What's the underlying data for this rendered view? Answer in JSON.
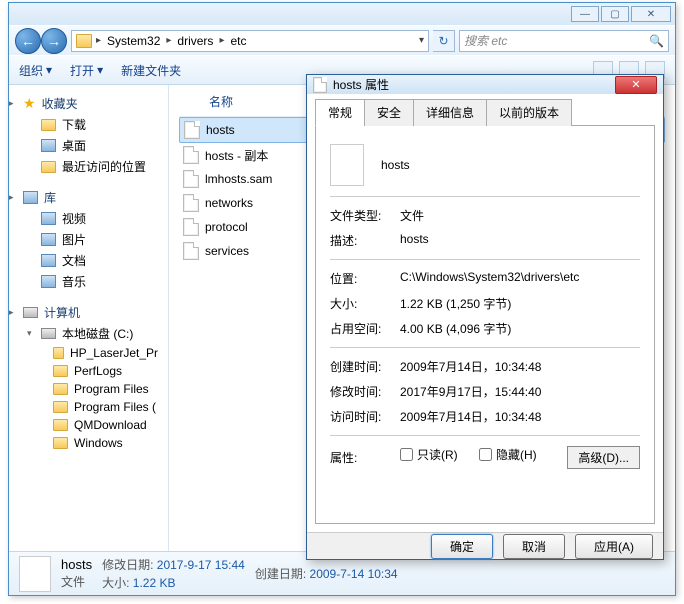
{
  "titlebar": {
    "min": "—",
    "max": "▢",
    "close": "✕"
  },
  "nav": {
    "back": "←",
    "forward": "→"
  },
  "breadcrumb": {
    "p1": "System32",
    "p2": "drivers",
    "p3": "etc"
  },
  "search": {
    "placeholder": "搜索 etc",
    "icon": "🔍"
  },
  "toolbar": {
    "organize": "组织",
    "open": "打开",
    "newfolder": "新建文件夹",
    "dropdown": "▾"
  },
  "sidebar": {
    "favorites": "收藏夹",
    "fav_items": [
      "下载",
      "桌面",
      "最近访问的位置"
    ],
    "libraries": "库",
    "lib_items": [
      "视频",
      "图片",
      "文档",
      "音乐"
    ],
    "computer": "计算机",
    "drives": [
      "本地磁盘 (C:)"
    ],
    "folders": [
      "HP_LaserJet_Pr",
      "PerfLogs",
      "Program Files",
      "Program Files (",
      "QMDownload",
      "Windows"
    ]
  },
  "filelist": {
    "header": "名称",
    "items": [
      "hosts",
      "hosts - 副本",
      "lmhosts.sam",
      "networks",
      "protocol",
      "services"
    ]
  },
  "details": {
    "name": "hosts",
    "type": "文件",
    "mod_label": "修改日期:",
    "mod_val": "2017-9-17 15:44",
    "size_label": "大小:",
    "size_val": "1.22 KB",
    "created_label": "创建日期:",
    "created_val": "2009-7-14 10:34"
  },
  "dialog": {
    "title": "hosts 属性",
    "tabs": [
      "常规",
      "安全",
      "详细信息",
      "以前的版本"
    ],
    "filename": "hosts",
    "rows": {
      "filetype_l": "文件类型:",
      "filetype_v": "文件",
      "desc_l": "描述:",
      "desc_v": "hosts",
      "loc_l": "位置:",
      "loc_v": "C:\\Windows\\System32\\drivers\\etc",
      "size_l": "大小:",
      "size_v": "1.22 KB (1,250 字节)",
      "disk_l": "占用空间:",
      "disk_v": "4.00 KB (4,096 字节)",
      "created_l": "创建时间:",
      "created_v": "2009年7月14日，10:34:48",
      "modified_l": "修改时间:",
      "modified_v": "2017年9月17日，15:44:40",
      "accessed_l": "访问时间:",
      "accessed_v": "2009年7月14日，10:34:48",
      "attr_l": "属性:"
    },
    "readonly": "只读(R)",
    "hidden": "隐藏(H)",
    "advanced": "高级(D)...",
    "ok": "确定",
    "cancel": "取消",
    "apply": "应用(A)"
  }
}
